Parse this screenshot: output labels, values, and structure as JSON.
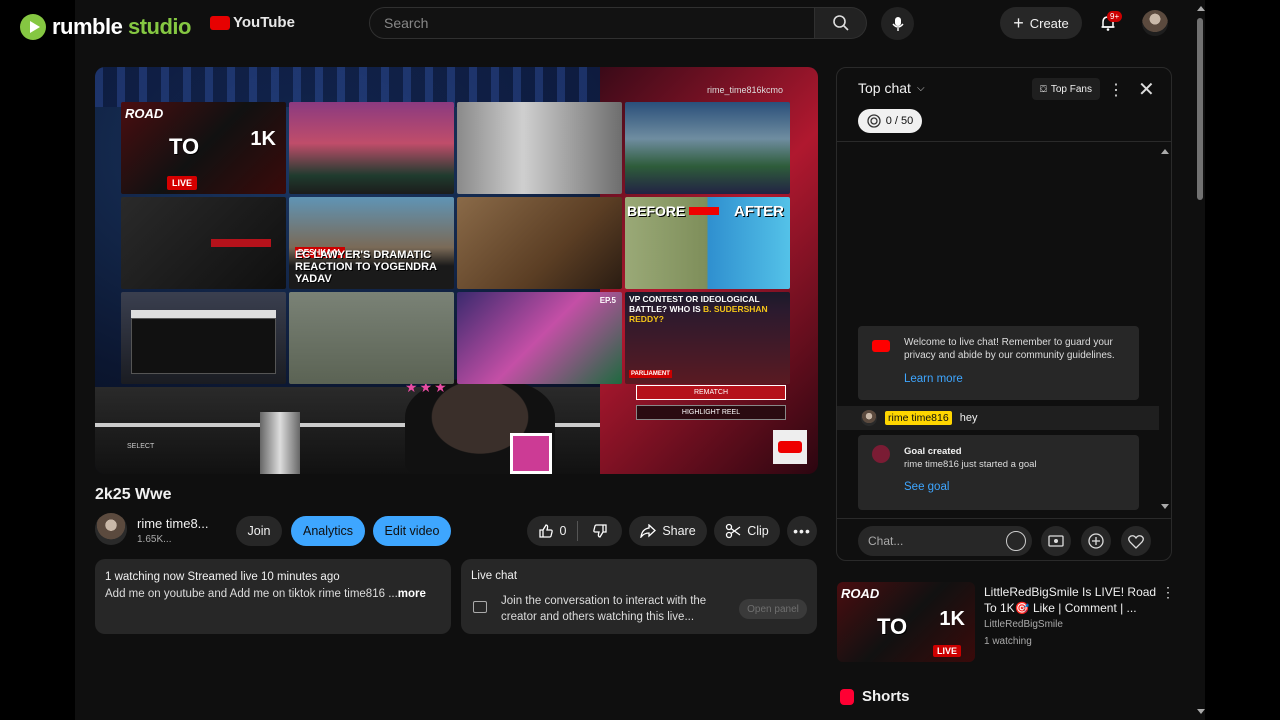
{
  "watermark": {
    "brand": "rumble",
    "suffix": "studio"
  },
  "youtube": {
    "logo_text": "YouTube"
  },
  "topbar": {
    "search_placeholder": "Search",
    "create_label": "Create",
    "notification_count": "9+"
  },
  "video": {
    "overlay_tag": "rime_time816kcmo",
    "tiles": {
      "road": "ROAD",
      "to": "TO",
      "onek": "1K",
      "live": "LIVE",
      "deshkaal": "DESHKAAL",
      "lawyer_caption": "EC LAWYER'S DRAMATIC REACTION TO YOGENDRA YADAV",
      "before": "BEFORE",
      "after": "AFTER",
      "vp_caption_a": "VP CONTEST OR IDEOLOGICAL BATTLE? WHO IS ",
      "vp_caption_b": "B. SUDERSHAN REDDY?",
      "ep": "EP.5",
      "parliament": "PARLIAMENT"
    },
    "rematch": "REMATCH",
    "highlight_reel": "HIGHLIGHT REEL",
    "select_label": "SELECT",
    "title": "2k25 Wwe"
  },
  "channel": {
    "name": "rime time8...",
    "subs": "1.65K..."
  },
  "actions": {
    "join": "Join",
    "analytics": "Analytics",
    "edit_video": "Edit video",
    "like_count": "0",
    "share": "Share",
    "clip": "Clip"
  },
  "description": {
    "stats": "1 watching now  Streamed live 10 minutes ago",
    "text": "Add me on youtube and Add me on tiktok rime time816 ...",
    "more": "more"
  },
  "live_chat_card": {
    "title": "Live chat",
    "text": "Join the conversation to interact with the creator and others watching this live...",
    "open_panel": "Open panel"
  },
  "chat": {
    "mode": "Top chat",
    "top_fans": "Top Fans",
    "goal_progress": "0 / 50",
    "welcome": "Welcome to live chat! Remember to guard your privacy and abide by our community guidelines.",
    "learn_more": "Learn more",
    "message_author": "rime time816",
    "message_text": "hey",
    "goal_title": "Goal created",
    "goal_sub": "rime time816 just started a goal",
    "see_goal": "See goal",
    "input_placeholder": "Chat..."
  },
  "recommendation": {
    "title": "LittleRedBigSmile Is LIVE! Road To 1K🎯 Like | Comment | ...",
    "channel": "LittleRedBigSmile",
    "watching": "1 watching",
    "live": "LIVE"
  },
  "shorts": {
    "label": "Shorts"
  },
  "colors": {
    "accent": "#3ea6ff",
    "live_red": "#ff0000",
    "rumble_green": "#85c742",
    "highlight_yellow": "#ffd600"
  }
}
